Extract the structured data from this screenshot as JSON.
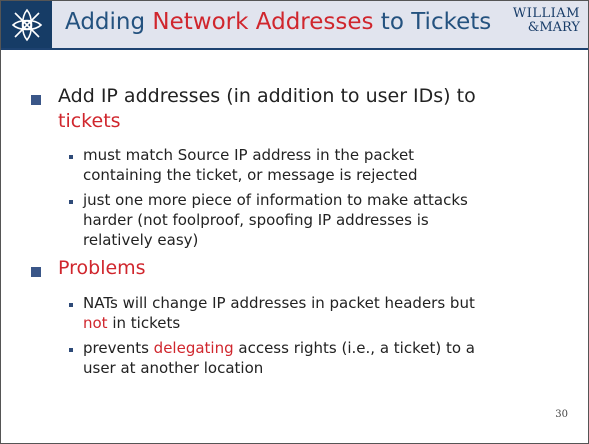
{
  "title": {
    "part1": "Adding ",
    "highlight": "Network Addresses",
    "part2": " to Tickets"
  },
  "brand": {
    "line1": "WILLIAM",
    "line2": "&MARY"
  },
  "bullets": [
    {
      "line1": "Add IP addresses (in addition to user IDs) to",
      "line2_red": "tickets",
      "subs": [
        {
          "lines": [
            "must match Source IP address in the packet",
            "containing the ticket, or message is rejected"
          ]
        },
        {
          "lines": [
            "just one more piece of information to make attacks",
            "harder (not foolproof, spoofing IP addresses is",
            "relatively easy)"
          ]
        }
      ]
    },
    {
      "label_red": "Problems",
      "subs": [
        {
          "line1": "NATs will change IP addresses in packet headers but",
          "line2_red": "not",
          "line2_rest": " in tickets"
        },
        {
          "line1_pre": "prevents ",
          "line1_red": "delegating",
          "line1_post": " access rights (i.e., a ticket) to a",
          "line2": "user at another location"
        }
      ]
    }
  ],
  "page_number": "30",
  "colors": {
    "accent_red": "#d0262d",
    "title_blue": "#24527f",
    "bar_bg": "#e1e4ee",
    "logo_bg": "#163c66"
  }
}
